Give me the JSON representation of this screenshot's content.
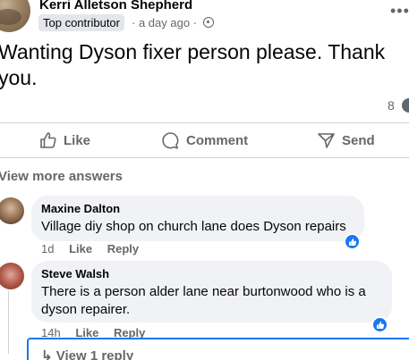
{
  "post": {
    "author": "Kerri Alletson Shepherd",
    "badge": "Top contributor",
    "time": "· a day ago ·",
    "text": "Wanting Dyson fixer person please. Thank you.",
    "reaction_count": "8"
  },
  "actions": {
    "like": "Like",
    "comment": "Comment",
    "send": "Send"
  },
  "view_more": "View more answers",
  "comments": [
    {
      "name": "Maxine Dalton",
      "text": "Village diy shop on church lane does Dyson repairs",
      "time": "1d",
      "like": "Like",
      "reply": "Reply"
    },
    {
      "name": "Steve Walsh",
      "text": "There is a person alder lane near burtonwood who is a dyson repairer.",
      "time": "14h",
      "like": "Like",
      "reply": "Reply"
    }
  ],
  "view_reply": "View 1 reply",
  "colors": {
    "accent": "#1877f2",
    "secondary_text": "#65676b",
    "bubble": "#f0f2f5"
  }
}
